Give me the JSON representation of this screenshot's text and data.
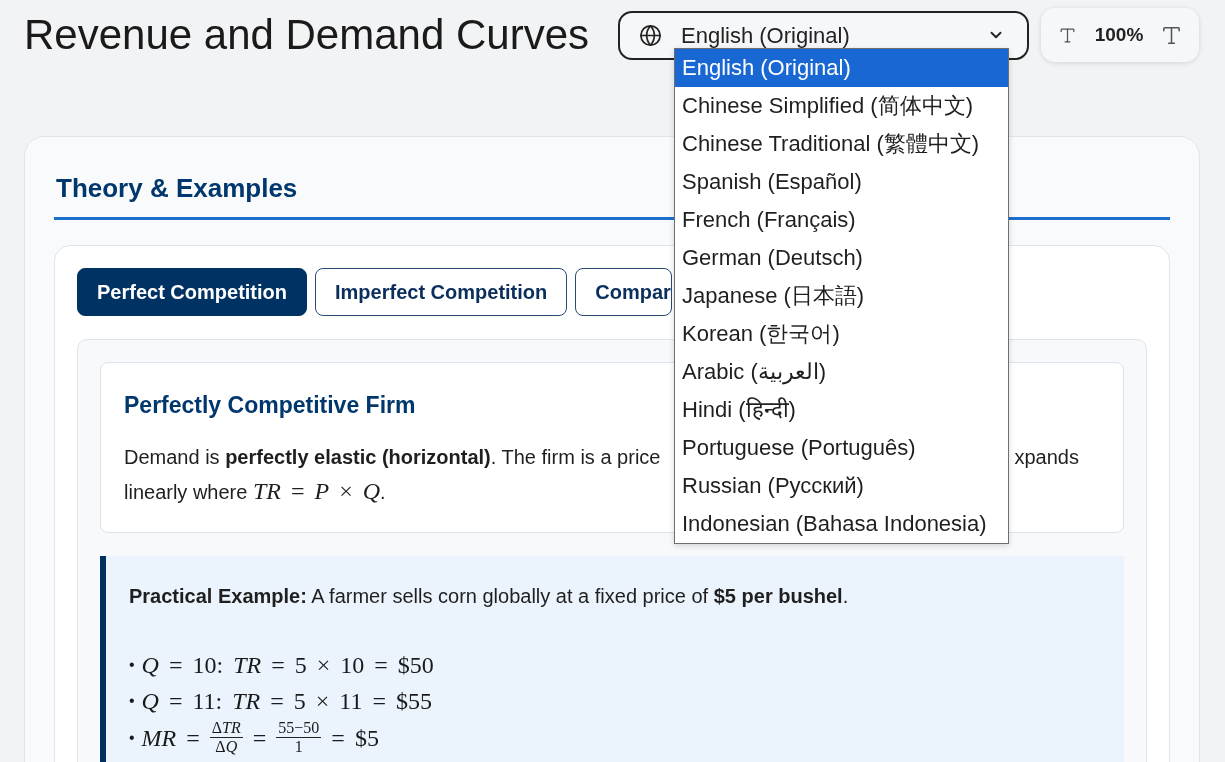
{
  "header": {
    "title": "Revenue and Demand Curves",
    "language_select": {
      "value": "English (Original)",
      "expanded": true,
      "options": [
        {
          "label": "English (Original)",
          "selected": true
        },
        {
          "label": "Chinese Simplified (简体中文)",
          "selected": false
        },
        {
          "label": "Chinese Traditional (繁體中文)",
          "selected": false
        },
        {
          "label": "Spanish (Español)",
          "selected": false
        },
        {
          "label": "French (Français)",
          "selected": false
        },
        {
          "label": "German (Deutsch)",
          "selected": false
        },
        {
          "label": "Japanese (日本語)",
          "selected": false
        },
        {
          "label": "Korean (한국어)",
          "selected": false
        },
        {
          "label": "Arabic (العربية)",
          "selected": false
        },
        {
          "label": "Hindi (हिन्दी)",
          "selected": false
        },
        {
          "label": "Portuguese (Português)",
          "selected": false
        },
        {
          "label": "Russian (Русский)",
          "selected": false
        },
        {
          "label": "Indonesian (Bahasa Indonesia)",
          "selected": false
        }
      ]
    },
    "font_size": {
      "reading": "100%"
    }
  },
  "section": {
    "heading": "Theory & Examples",
    "tabs": [
      {
        "label": "Perfect Competition",
        "selected": true
      },
      {
        "label": "Imperfect Competition",
        "selected": false
      },
      {
        "label": "Compar",
        "selected": false
      }
    ],
    "firm_card": {
      "heading": "Perfectly Competitive Firm",
      "description": {
        "start": "Demand is **perfectly elastic (horizontal)**. The firm is a price",
        "end": "xpands",
        "continuation": "linearly where",
        "formula": "*TR* = *P* × *Q*",
        "closing": "."
      }
    },
    "example": {
      "intro": "**Practical Example:** A farmer sells corn globally at a fixed price of **$5 per bushel**.",
      "lines": [
        {
          "marker": "•",
          "terms": [
            {
              "kind": "text",
              "math": "*Q* = 10: *TR* = 5 × 10 = $50"
            }
          ]
        },
        {
          "marker": "•",
          "terms": [
            {
              "kind": "text",
              "math": "*Q* = 11: *TR* = 5 × 11 = $55"
            }
          ]
        },
        {
          "marker": "•",
          "terms": [
            {
              "kind": "text",
              "math": "*MR* ="
            },
            {
              "kind": "fraction",
              "numerator": [
                "Δ",
                "*TR*"
              ],
              "denominator": [
                "Δ",
                "*Q*"
              ]
            },
            {
              "kind": "text",
              "math": "="
            },
            {
              "kind": "fraction",
              "numerator": [
                "55−50"
              ],
              "denominator": [
                "1"
              ]
            },
            {
              "kind": "text",
              "math": "= $5"
            }
          ]
        }
      ]
    }
  }
}
